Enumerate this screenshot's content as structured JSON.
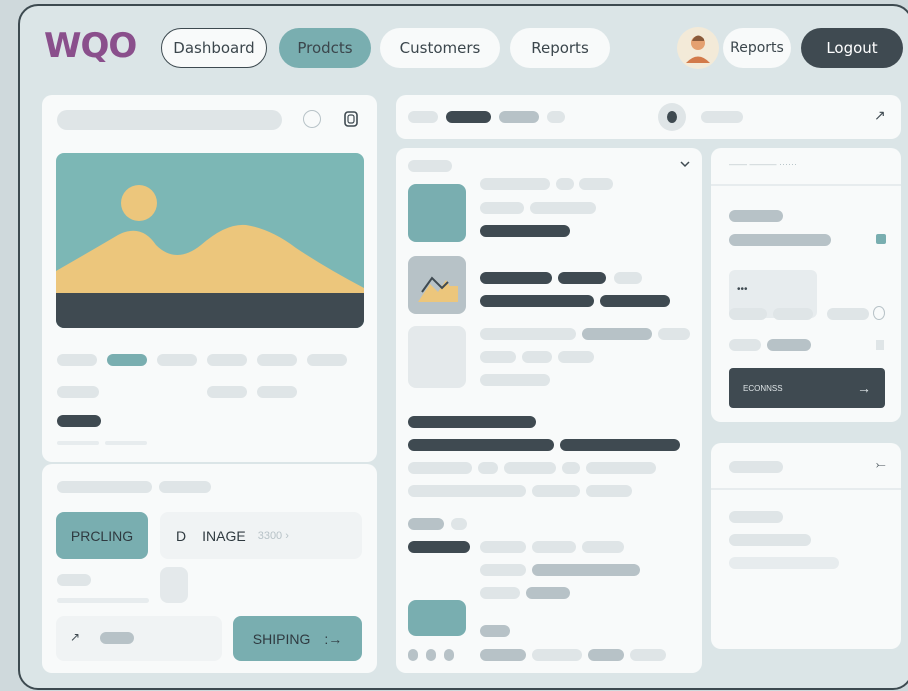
{
  "header": {
    "logo": "WQO",
    "nav": {
      "dashboard": "Dashboard",
      "products": "Prodcts",
      "customers": "Customers",
      "reports": "Reports"
    },
    "user_reports": "Reports",
    "logout": "Logout"
  },
  "left_bottom": {
    "pricing_label": "PRCLING",
    "image_letter": "D",
    "image_label": "INAGE",
    "image_value": "3300 ›",
    "shipping_label": "SHIPING",
    "shipping_arrow": ":→",
    "row_prefix": "↗"
  },
  "right_panel": {
    "header_text": "—— ——— ⋯⋯",
    "dots": "•••",
    "action_label": "ECONNSS",
    "action_arrow": "→",
    "corner_icon": "↗",
    "bottom_corner": "⤚"
  },
  "colors": {
    "accent_teal": "#79aeb0",
    "dark": "#3f4a51",
    "logo": "#8a4f8c",
    "sand": "#ecc67c"
  }
}
